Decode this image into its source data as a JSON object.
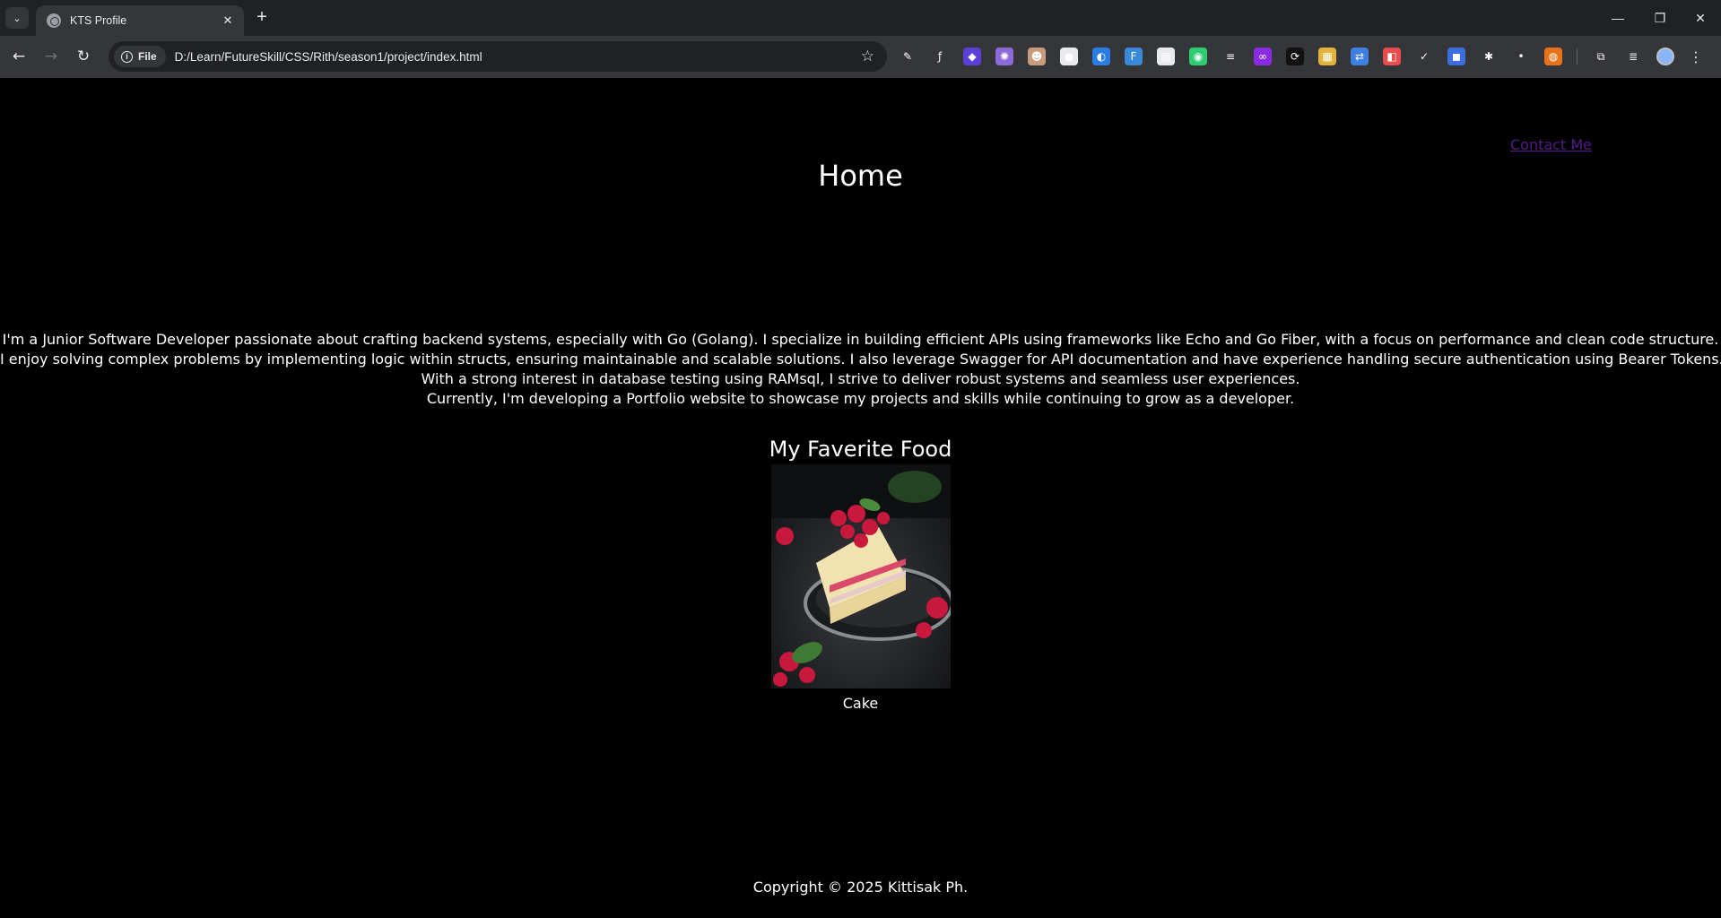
{
  "browser": {
    "tab": {
      "title": "KTS Profile",
      "close": "✕"
    },
    "new_tab": "+",
    "window": {
      "minimize": "—",
      "restore": "❐",
      "close": "✕"
    },
    "nav": {
      "back": "←",
      "forward": "→",
      "reload": "↻"
    },
    "address": {
      "chip_label": "File",
      "url": "D:/Learn/FutureSkill/CSS/Rith/season1/project/index.html"
    },
    "extensions": [
      {
        "icon": "eyedropper-icon",
        "glyph": "✎",
        "color": "#35363a"
      },
      {
        "icon": "font-function-icon",
        "glyph": "ƒ",
        "color": "#35363a"
      },
      {
        "icon": "cube-icon",
        "glyph": "◆",
        "color": "#5b3fd6"
      },
      {
        "icon": "gear-purple-icon",
        "glyph": "✺",
        "color": "#8e6ad8"
      },
      {
        "icon": "face-icon",
        "glyph": "☻",
        "color": "#c89b7b"
      },
      {
        "icon": "circle-icon",
        "glyph": "●",
        "color": "#e8eaed"
      },
      {
        "icon": "swirl-icon",
        "glyph": "◐",
        "color": "#2a7de1"
      },
      {
        "icon": "ft-icon",
        "glyph": "F",
        "color": "#3b8ad9"
      },
      {
        "icon": "calendar-icon",
        "glyph": "▤",
        "color": "#e8eaed"
      },
      {
        "icon": "compass-icon",
        "glyph": "◉",
        "color": "#2ecc71"
      },
      {
        "icon": "sliders-icon",
        "glyph": "≡",
        "color": "#35363a"
      },
      {
        "icon": "infinity-icon",
        "glyph": "∞",
        "color": "#8a2be2"
      },
      {
        "icon": "loop-icon",
        "glyph": "⟳",
        "color": "#111111"
      },
      {
        "icon": "grid-icon",
        "glyph": "▦",
        "color": "#e2b43b"
      },
      {
        "icon": "translate-icon",
        "glyph": "⇄",
        "color": "#3f7fe0"
      },
      {
        "icon": "toggle-icon",
        "glyph": "◧",
        "color": "#e84c4c"
      },
      {
        "icon": "check-icon",
        "glyph": "✓",
        "color": "#35363a"
      },
      {
        "icon": "bookmark-icon",
        "glyph": "◼",
        "color": "#3b6fe0"
      },
      {
        "icon": "bug-icon",
        "glyph": "✱",
        "color": "#35363a"
      },
      {
        "icon": "dot-icon",
        "glyph": "•",
        "color": "#35363a"
      },
      {
        "icon": "ball-icon",
        "glyph": "◍",
        "color": "#e8731b"
      },
      {
        "icon": "puzzle-icon",
        "glyph": "⧉",
        "color": "#35363a"
      }
    ],
    "media_icon": "≣",
    "menu": "⋮"
  },
  "page": {
    "contact_link": "Contact Me",
    "title": "Home",
    "bio": [
      "I'm a Junior Software Developer passionate about crafting backend systems, especially with Go (Golang). I specialize in building efficient APIs using frameworks like Echo and Go Fiber, with a focus on performance and clean code structure.",
      "I enjoy solving complex problems by implementing logic within structs, ensuring maintainable and scalable solutions. I also leverage Swagger for API documentation and have experience handling secure authentication using Bearer Tokens.",
      "With a strong interest in database testing using RAMsql, I strive to deliver robust systems and seamless user experiences.",
      "Currently, I'm developing a Portfolio website to showcase my projects and skills while continuing to grow as a developer."
    ],
    "food_title": "My Faverite Food",
    "food_caption": "Cake",
    "footer": "Copyright © 2025 Kittisak Ph."
  },
  "colors": {
    "link_visited": "#551a8b",
    "background": "#000000",
    "text": "#ffffff"
  }
}
